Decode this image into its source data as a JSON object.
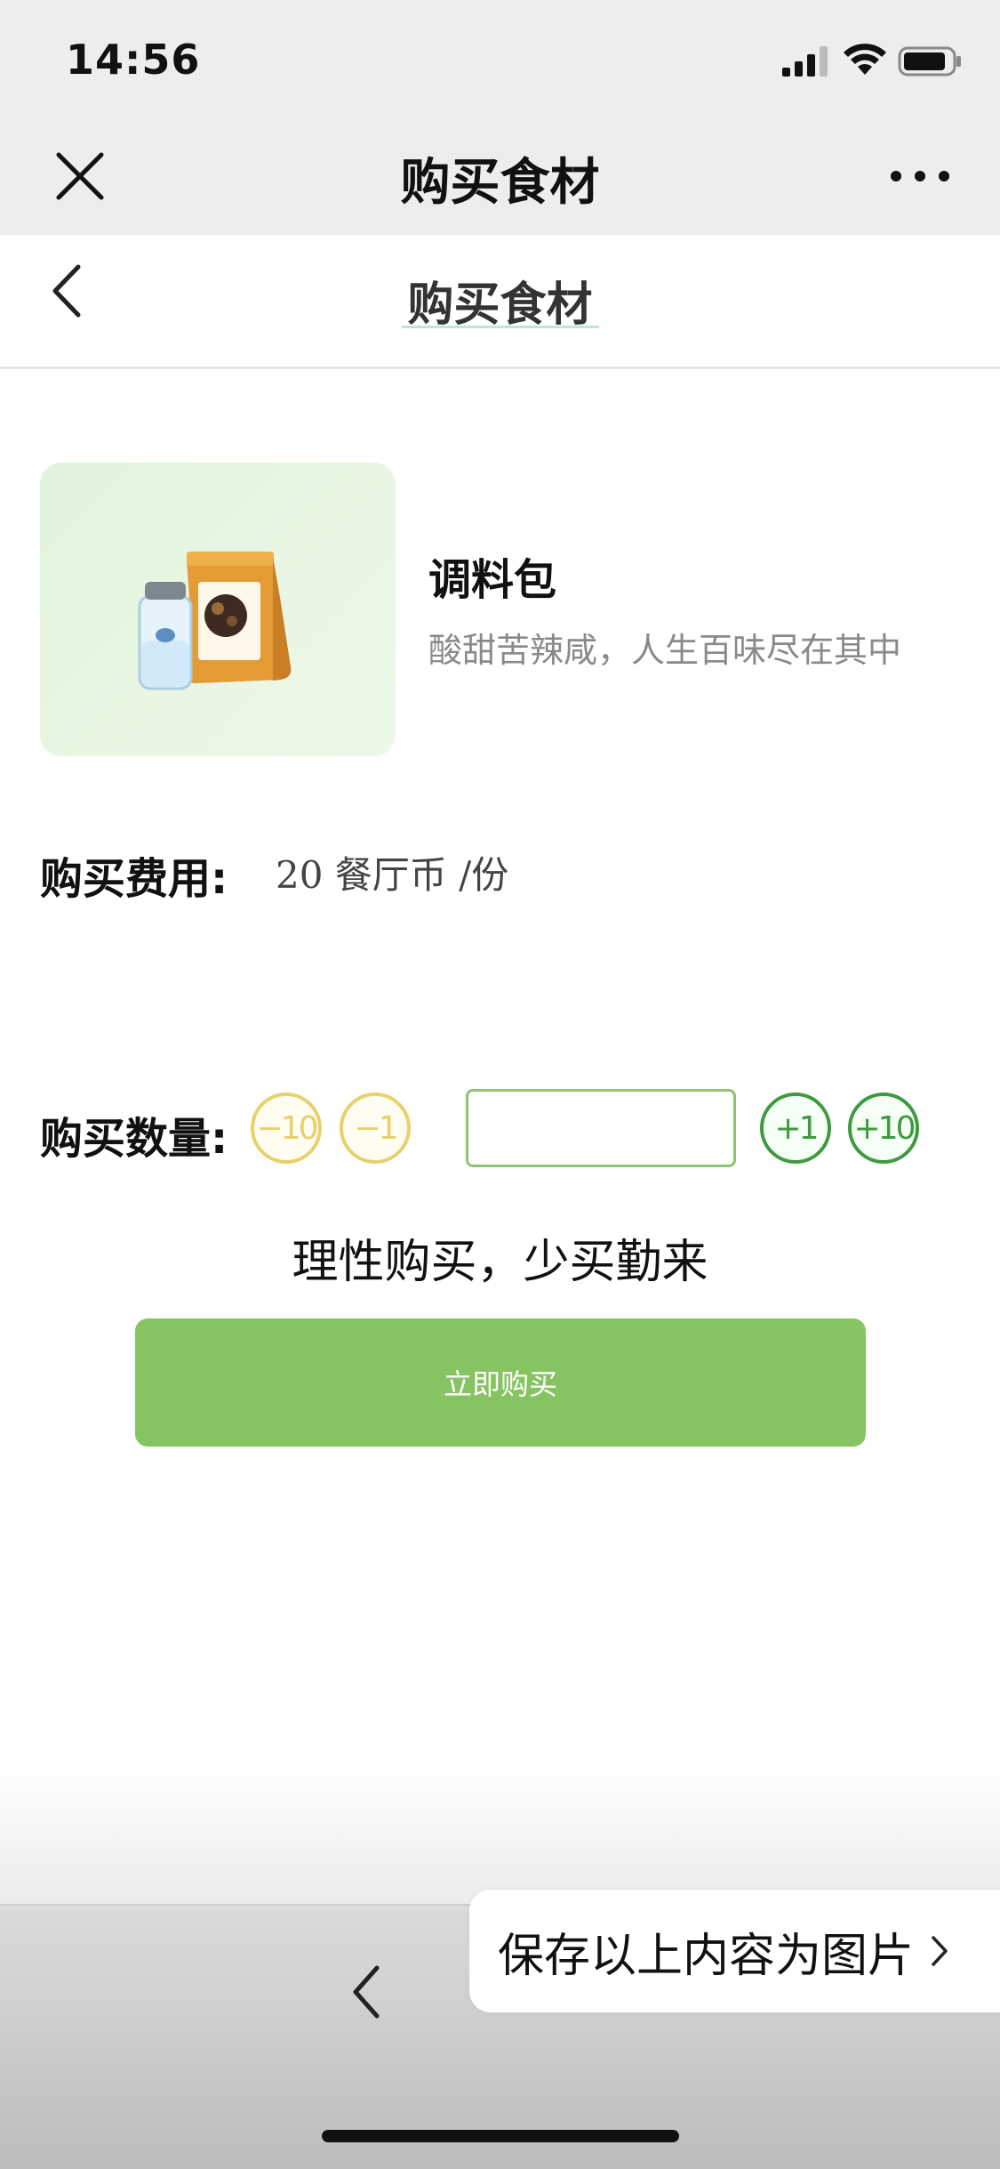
{
  "status_bar": {
    "time": "14:56"
  },
  "wechat_nav": {
    "title": "购买食材"
  },
  "header": {
    "title": "购买食材"
  },
  "product": {
    "name": "调料包",
    "description": "酸甜苦辣咸，人生百味尽在其中",
    "image_icon": "seasoning-package-icon"
  },
  "fee": {
    "label": "购买费用:",
    "value": "20 餐厅币 /份"
  },
  "quantity": {
    "label": "购买数量:",
    "minus10": "−10",
    "minus1": "−1",
    "plus1": "+1",
    "plus10": "+10",
    "value": "",
    "placeholder": ""
  },
  "slogan": "理性购买，少买勤来",
  "buy_button": "立即购买",
  "save_prompt": "保存以上内容为图片",
  "colors": {
    "accent_green": "#86c462",
    "minus_yellow": "#e8d06a",
    "plus_green": "#3e9a3e"
  }
}
